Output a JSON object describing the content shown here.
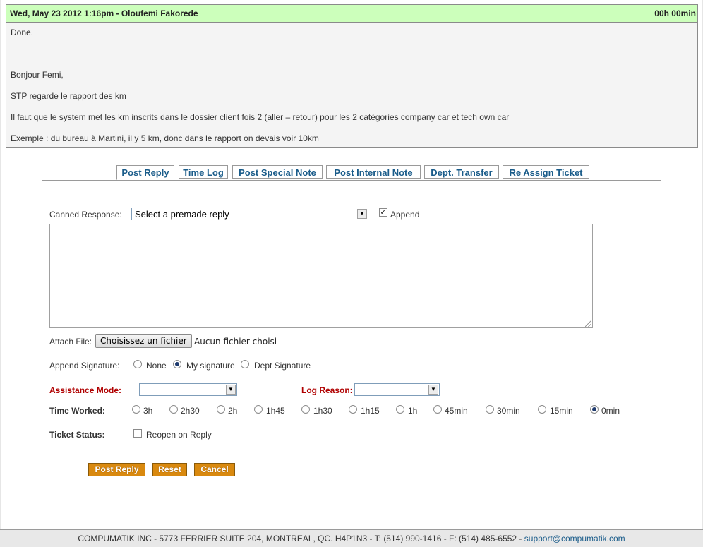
{
  "message": {
    "header_left": "Wed, May 23 2012 1:16pm - Oloufemi Fakorede",
    "header_right": "00h 00min",
    "lines": [
      "Done.",
      "Bonjour Femi,",
      "STP regarde le rapport des km",
      "Il faut que le system met les km inscrits dans le dossier client fois 2 (aller – retour) pour les 2 catégories company car et tech own car",
      "Exemple : du bureau à Martini, il y 5 km, donc dans le rapport on devais voir 10km"
    ]
  },
  "tabs": [
    {
      "label": "Post Reply",
      "active": true
    },
    {
      "label": "Time Log"
    },
    {
      "label": "Post Special Note"
    },
    {
      "label": "Post Internal Note"
    },
    {
      "label": "Dept. Transfer"
    },
    {
      "label": "Re Assign Ticket"
    }
  ],
  "form": {
    "canned_label": "Canned Response:",
    "canned_value": "Select a premade reply",
    "append_label": "Append",
    "append_checked": true,
    "attach_label": "Attach File:",
    "file_button": "Choisissez un fichier",
    "file_status": "Aucun fichier choisi",
    "signature_label": "Append Signature:",
    "signature_options": [
      "None",
      "My signature",
      "Dept Signature"
    ],
    "signature_selected": "My signature",
    "assistance_label": "Assistance Mode:",
    "assistance_value": "",
    "log_reason_label": "Log Reason:",
    "log_reason_value": "",
    "time_worked_label": "Time Worked:",
    "time_options": [
      "3h",
      "2h30",
      "2h",
      "1h45",
      "1h30",
      "1h15",
      "1h",
      "45min",
      "30min",
      "15min",
      "0min"
    ],
    "time_selected": "0min",
    "ticket_status_label": "Ticket Status:",
    "reopen_label": "Reopen on Reply",
    "reopen_checked": false
  },
  "buttons": {
    "post_reply": "Post Reply",
    "reset": "Reset",
    "cancel": "Cancel"
  },
  "footer": {
    "text": "COMPUMATIK INC - 5773 FERRIER SUITE 204, MONTREAL, QC. H4P1N3 - T: (514) 990-1416 - F: (514) 485-6552 - ",
    "email": "support@compumatik.com"
  },
  "colors": {
    "header_bg": "#ccffbb",
    "tab_text": "#1a5c8a",
    "button_bg": "#d9890f",
    "required_label": "#b00000"
  }
}
